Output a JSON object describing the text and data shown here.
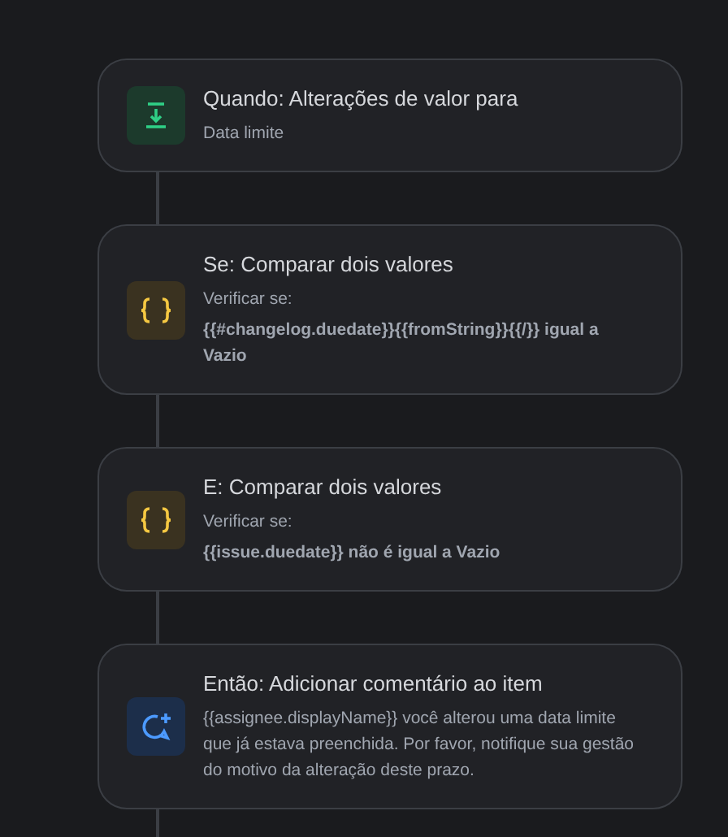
{
  "steps": [
    {
      "kind": "trigger",
      "title": "Quando: Alterações de valor para",
      "lines": [
        {
          "text": "Data limite",
          "bold": false
        }
      ]
    },
    {
      "kind": "condition",
      "title": "Se: Comparar dois valores",
      "lines": [
        {
          "text": "Verificar se:",
          "bold": false
        },
        {
          "text": "{{#changelog.duedate}}{{fromString}}{{/}} igual a Vazio",
          "bold": true
        }
      ]
    },
    {
      "kind": "condition",
      "title": "E: Comparar dois valores",
      "lines": [
        {
          "text": "Verificar se:",
          "bold": false
        },
        {
          "text": "{{issue.duedate}} não é igual a Vazio",
          "bold": true
        }
      ]
    },
    {
      "kind": "action",
      "title": "Então: Adicionar comentário ao item",
      "lines": [
        {
          "text": "{{assignee.displayName}} você alterou uma data limite que já estava preenchida. Por favor, notifique sua gestão do motivo da alteração deste prazo.",
          "bold": false
        }
      ]
    }
  ]
}
